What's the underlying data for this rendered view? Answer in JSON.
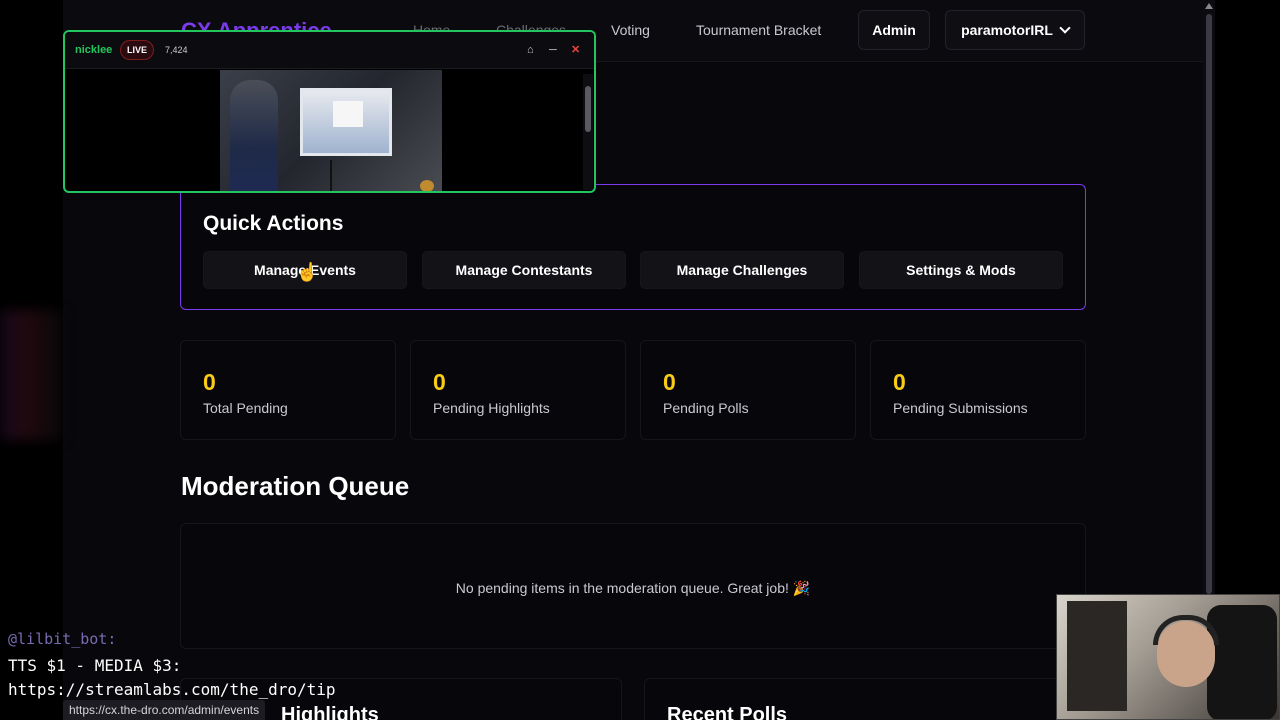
{
  "navbar": {
    "brand": "CX Apprentice",
    "links": [
      "Home",
      "Challenges",
      "Voting",
      "Tournament Bracket"
    ],
    "admin_label": "Admin",
    "user_label": "paramotorIRL"
  },
  "popup": {
    "streamer": "nicklee",
    "live": "LIVE",
    "viewers": "7,424"
  },
  "quick_actions": {
    "title": "Quick Actions",
    "buttons": [
      "Manage Events",
      "Manage Contestants",
      "Manage Challenges",
      "Settings & Mods"
    ]
  },
  "stats": [
    {
      "value": "0",
      "label": "Total Pending"
    },
    {
      "value": "0",
      "label": "Pending Highlights"
    },
    {
      "value": "0",
      "label": "Pending Polls"
    },
    {
      "value": "0",
      "label": "Pending Submissions"
    }
  ],
  "moderation_queue": {
    "title": "Moderation Queue",
    "empty_message": "No pending items in the moderation queue. Great job! 🎉"
  },
  "bottom_sections": [
    "Highlights",
    "Recent Polls"
  ],
  "chat": {
    "user": "@lilbit_bot:",
    "line1": "TTS $1 - MEDIA $3:",
    "line2": "https://streamlabs.com/the_dro/tip"
  },
  "status_bar_url": "https://cx.the-dro.com/admin/events",
  "colors": {
    "accent_purple": "#7c3aed",
    "stat_yellow": "#facc15",
    "live_green": "#22c55e"
  }
}
